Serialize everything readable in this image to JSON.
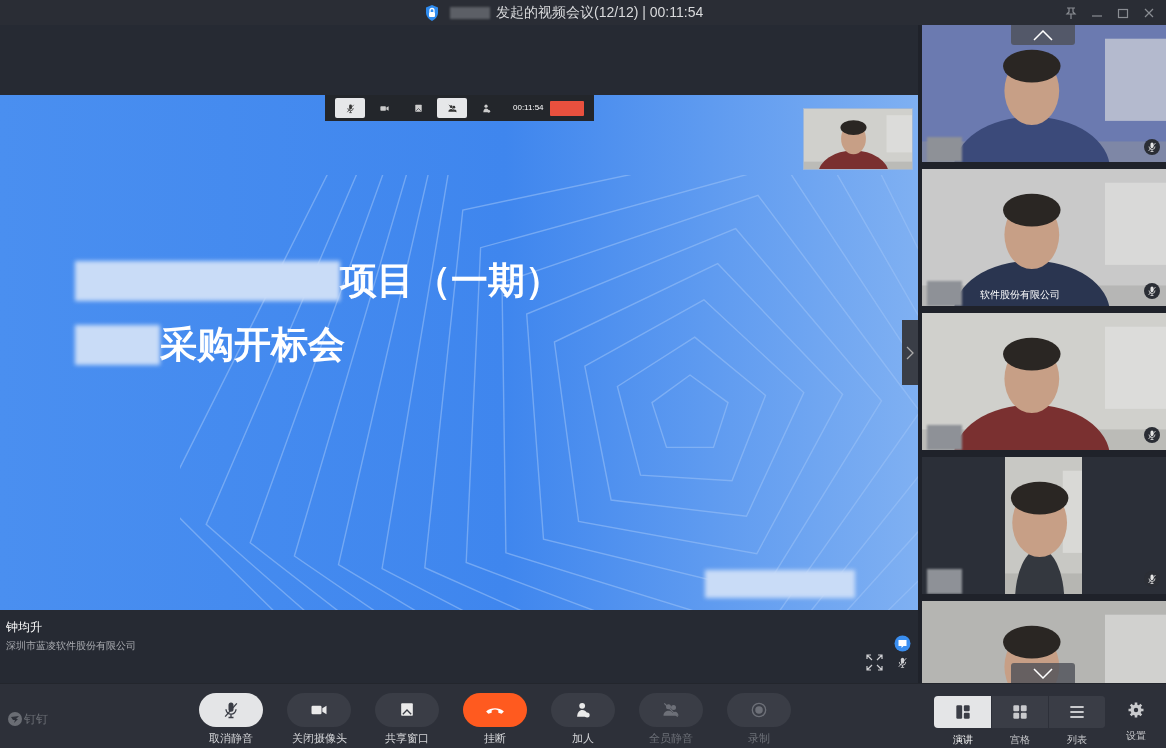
{
  "window": {
    "title": "发起的视频会议(12/12) | 00:11:54"
  },
  "shared_screen": {
    "mini_toolbar": {
      "timer": "00:11:54",
      "items": [
        {
          "kind": "mic",
          "selected": true
        },
        {
          "kind": "camera",
          "selected": false
        },
        {
          "kind": "share",
          "selected": false
        },
        {
          "kind": "mute_all",
          "selected": true
        },
        {
          "kind": "add",
          "selected": false
        }
      ]
    },
    "slide": {
      "title_line_1": "项目（一期）",
      "title_line_2": "采购开标会"
    }
  },
  "presenter": {
    "name": "钟均升",
    "company": "深圳市蓝凌软件股份有限公司"
  },
  "participants": [
    {
      "kind": "landscape",
      "muted": true
    },
    {
      "kind": "landscape",
      "muted": true,
      "caption": "软件股份有限公司"
    },
    {
      "kind": "landscape",
      "muted": true
    },
    {
      "kind": "portrait",
      "muted": true
    },
    {
      "kind": "landscape"
    }
  ],
  "toolbar": {
    "logo": "钉钉",
    "buttons": [
      {
        "kind": "mic",
        "label": "取消静音",
        "selected": true,
        "disabled": false
      },
      {
        "kind": "camera",
        "label": "关闭摄像头",
        "selected": false,
        "disabled": false
      },
      {
        "kind": "share",
        "label": "共享窗口",
        "selected": false,
        "disabled": false
      },
      {
        "kind": "hangup",
        "label": "挂断",
        "selected": false,
        "disabled": false
      },
      {
        "kind": "add",
        "label": "加人",
        "selected": false,
        "disabled": false
      },
      {
        "kind": "mute_all",
        "label": "全员静音",
        "selected": false,
        "disabled": true
      },
      {
        "kind": "record",
        "label": "录制",
        "selected": false,
        "disabled": true
      }
    ]
  },
  "view_modes": [
    {
      "kind": "speaker",
      "label": "演讲",
      "selected": true
    },
    {
      "kind": "grid",
      "label": "宫格",
      "selected": false
    },
    {
      "kind": "list",
      "label": "列表",
      "selected": false
    }
  ],
  "settings": {
    "label": "设置"
  }
}
